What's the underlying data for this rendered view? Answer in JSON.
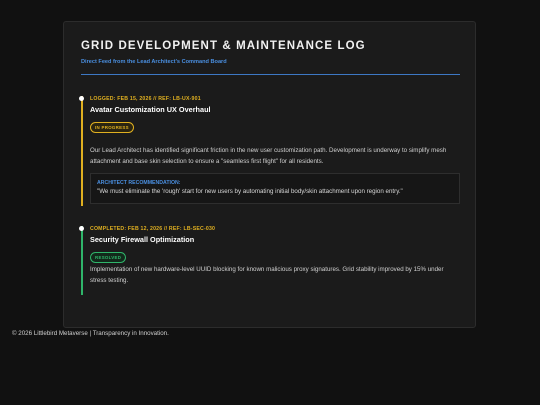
{
  "header": {
    "title": "GRID DEVELOPMENT & MAINTENANCE LOG",
    "subtitle": "Direct Feed from the Lead Architect's Command Board",
    "accent_color": "#3d78c4"
  },
  "entries": [
    {
      "meta": "LOGGED: FEB 15, 2026 // REF: LB-UX-901",
      "title": "Avatar Customization UX Overhaul",
      "status": "IN PROGRESS",
      "status_color": "#e0b020",
      "body": "Our Lead Architect has identified significant friction in the new user customization path. Development is underway to simplify mesh attachment and base skin selection to ensure a \"seamless first flight\" for all residents.",
      "note_label": "ARCHITECT RECOMMENDATION:",
      "note_text": "\"We must eliminate the 'rough' start for new users by automating initial body/skin attachment upon region entry.\""
    },
    {
      "meta": "COMPLETED: FEB 12, 2026 // REF: LB-SEC-030",
      "title": "Security Firewall Optimization",
      "status": "RESOLVED",
      "status_color": "#2fb56a",
      "body": "Implementation of new hardware-level UUID blocking for known malicious proxy signatures. Grid stability improved by 15% under stress testing."
    }
  ],
  "footer": {
    "text": "© 2026 Littlebird Metaverse | Transparency in Innovation."
  }
}
